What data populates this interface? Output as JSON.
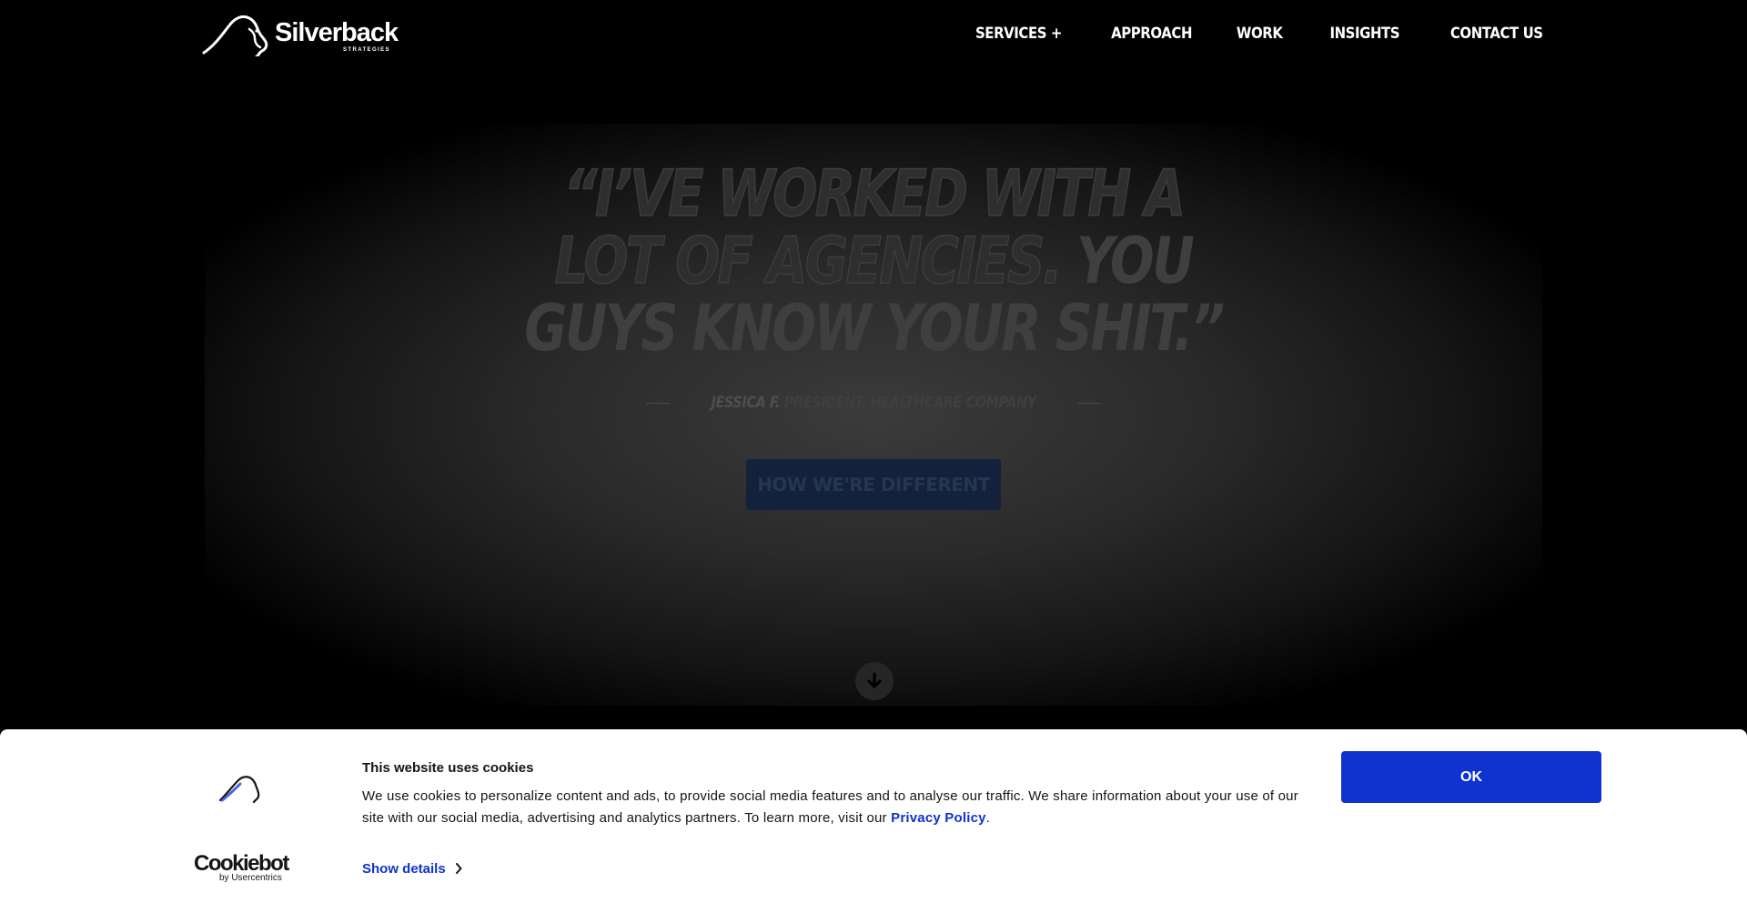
{
  "header": {
    "logo": {
      "wordmark": "Silverback",
      "tagline": "STRATEGIES"
    },
    "nav": [
      {
        "label": "SERVICES +"
      },
      {
        "label": "APPROACH"
      },
      {
        "label": "WORK"
      },
      {
        "label": "INSIGHTS"
      },
      {
        "label": "CONTACT US"
      }
    ]
  },
  "hero": {
    "quote_lines": [
      "“I’VE WORKED WITH A",
      "LOT OF AGENCIES.",
      "YOU",
      "GUYS KNOW YOUR SHIT.”"
    ],
    "attribution": {
      "name": "JESSICA F.",
      "role": "PRESIDENT, HEALTHCARE COMPANY"
    },
    "cta_label": "HOW WE'RE DIFFERENT",
    "scroll_icon": "arrow-down-circle-icon"
  },
  "cookie_banner": {
    "title": "This website uses cookies",
    "body": "We use cookies to personalize content and ads, to provide social media features and to analyse our traffic. We share information about your use of our site with our social media, advertising and analytics partners. To learn more, visit our ",
    "link_label": "Privacy Policy",
    "body_end": ".",
    "show_details_label": "Show details",
    "ok_label": "OK",
    "brand": {
      "name": "Cookiebot",
      "by": "by Usercentrics"
    }
  },
  "colors": {
    "background": "#000000",
    "accent_blue": "#1032cf",
    "cta_dim": "#14213b",
    "banner_bg": "#ffffff"
  }
}
